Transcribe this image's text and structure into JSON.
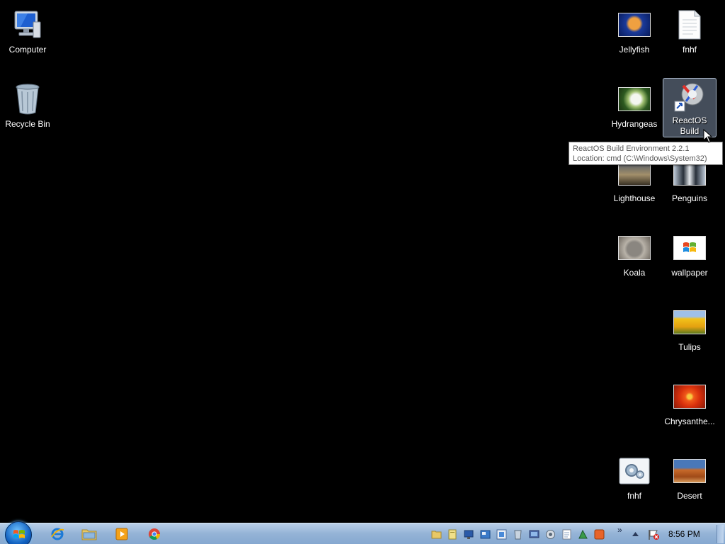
{
  "desktop": {
    "icons": [
      {
        "label": "Computer",
        "icon": "computer-icon"
      },
      {
        "label": "Recycle Bin",
        "icon": "recycle-bin-icon"
      },
      {
        "label": "Jellyfish",
        "icon": "image-thumbnail-icon"
      },
      {
        "label": "fnhf",
        "icon": "text-file-icon"
      },
      {
        "label": "Hydrangeas",
        "icon": "image-thumbnail-icon"
      },
      {
        "label": "ReactOS Build Environm...",
        "icon": "shortcut-icon"
      },
      {
        "label": "Lighthouse",
        "icon": "image-thumbnail-icon"
      },
      {
        "label": "Penguins",
        "icon": "image-thumbnail-icon"
      },
      {
        "label": "Koala",
        "icon": "image-thumbnail-icon"
      },
      {
        "label": "wallpaper",
        "icon": "image-thumbnail-icon"
      },
      {
        "label": "Tulips",
        "icon": "image-thumbnail-icon"
      },
      {
        "label": "Chrysanthe...",
        "icon": "image-thumbnail-icon"
      },
      {
        "label": "fnhf",
        "icon": "settings-file-icon"
      },
      {
        "label": "Desert",
        "icon": "image-thumbnail-icon"
      }
    ]
  },
  "tooltip": {
    "line1": "ReactOS Build Environment 2.2.1",
    "line2": "Location: cmd (C:\\Windows\\System32)"
  },
  "taskbar": {
    "start_icon": "windows-logo-icon",
    "pinned": [
      "internet-explorer-icon",
      "file-explorer-icon",
      "media-player-icon",
      "chrome-icon"
    ],
    "tray": [
      "folder-icon",
      "document-icon",
      "network-icon",
      "app-icon",
      "app-icon",
      "app-icon",
      "app-icon",
      "app-icon",
      "notepad-icon",
      "app-icon",
      "app-icon"
    ],
    "overflow_label": "»",
    "clock": "8:56 PM"
  },
  "colors": {
    "desktop_bg": "#000000",
    "taskbar_bg": "#94b3d6"
  }
}
